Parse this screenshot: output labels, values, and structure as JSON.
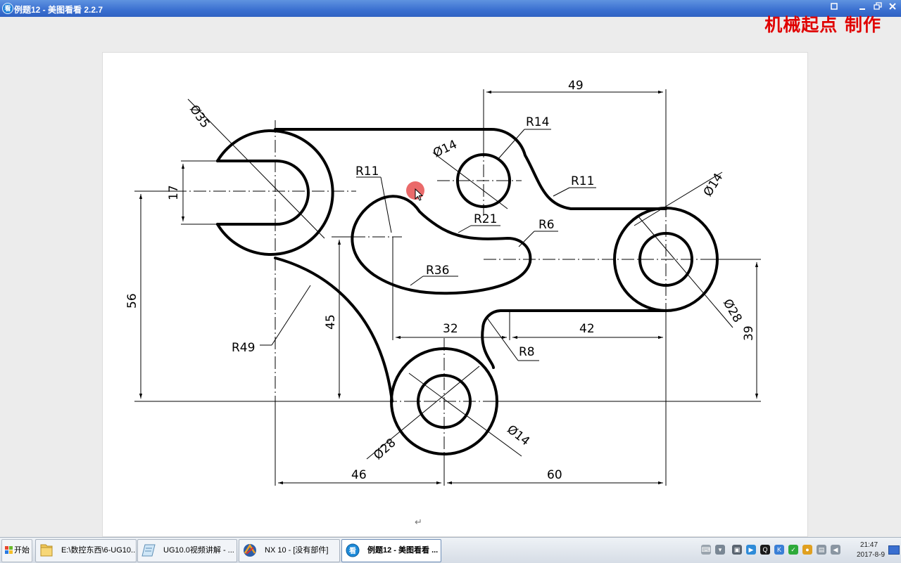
{
  "window": {
    "title": "例题12 - 美图看看 2.2.7",
    "icon": "meitu-kankan-app-icon",
    "buttons": [
      "pin",
      "minimize",
      "restore",
      "close"
    ]
  },
  "watermark": {
    "text": "机械起点 制作",
    "color": "#e00000"
  },
  "drawing": {
    "dimensions": {
      "d35": "Ø35",
      "d17": "17",
      "d49": "49",
      "r14": "R14",
      "d14_top": "Ø14",
      "r11_left": "R11",
      "r11_right": "R11",
      "r21": "R21",
      "r6": "R6",
      "r36": "R36",
      "d14_right": "Ø14",
      "d28_right": "Ø28",
      "d56": "56",
      "d45": "45",
      "r49": "R49",
      "d32": "32",
      "d42": "42",
      "r8": "R8",
      "d39": "39",
      "d28_bottom": "Ø28",
      "d14_bottom": "Ø14",
      "d46": "46",
      "d60": "60"
    },
    "return_mark": "↵"
  },
  "taskbar": {
    "start_label": "开始",
    "tasks": [
      {
        "label": "E:\\数控东西\\6-UG10...",
        "icon": "folder-icon"
      },
      {
        "label": "UG10.0视频讲解 - ...",
        "icon": "document-icon"
      },
      {
        "label": "NX 10 - [没有部件]",
        "icon": "nx-icon"
      },
      {
        "label": "例题12 - 美图看看 ...",
        "icon": "meitu-icon",
        "active": true
      }
    ],
    "clock": {
      "time": "21:47",
      "date": "2017-8-9"
    }
  },
  "colors": {
    "titlebar": "#3a6fd0",
    "watermark": "#e00000",
    "cursor_highlight": "#e65050"
  }
}
